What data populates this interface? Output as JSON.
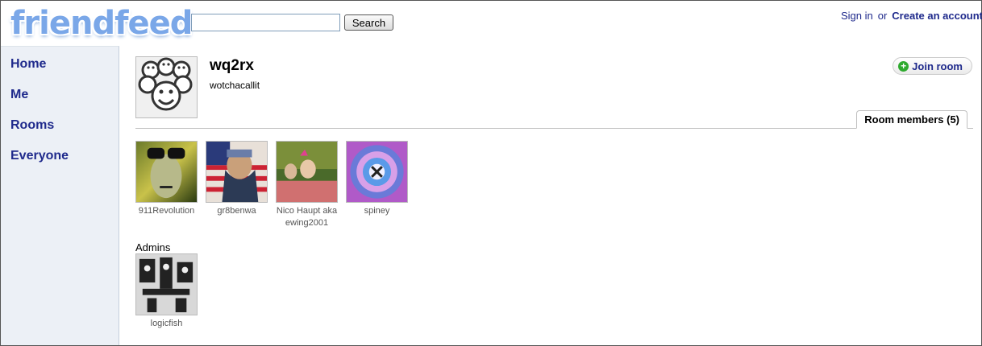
{
  "header": {
    "logo": "friendfeed",
    "search_placeholder": "",
    "search_button": "Search",
    "sign_in": "Sign in",
    "or": "or",
    "create_account": "Create an account"
  },
  "sidebar": {
    "items": [
      {
        "label": "Home"
      },
      {
        "label": "Me"
      },
      {
        "label": "Rooms"
      },
      {
        "label": "Everyone"
      }
    ]
  },
  "room": {
    "name": "wq2rx",
    "description": "wotchacallit",
    "join_label": "Join room",
    "tab_label": "Room members (5)"
  },
  "members": [
    {
      "name": "911Revolution"
    },
    {
      "name": "gr8benwa"
    },
    {
      "name": "Nico Haupt aka ewing2001"
    },
    {
      "name": "spiney"
    }
  ],
  "admins_label": "Admins",
  "admins": [
    {
      "name": "logicfish"
    }
  ],
  "colors": {
    "link": "#1f2a8c",
    "sidebar_bg": "#ecf0f6",
    "logo": "#7aa7e8",
    "join_icon": "#2eaa2e"
  }
}
